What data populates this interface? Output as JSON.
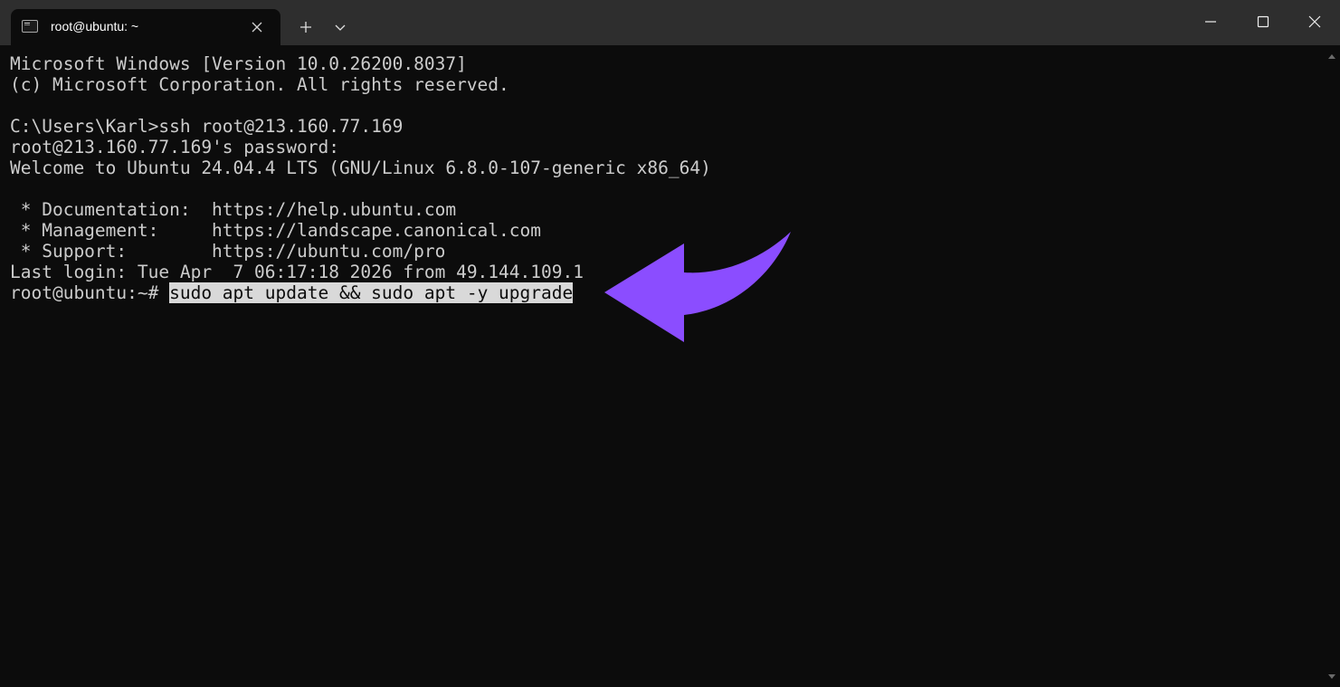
{
  "window": {
    "tab_title": "root@ubuntu: ~",
    "icons": {
      "tab": "terminal-icon",
      "tab_close": "close-icon",
      "new_tab": "plus-icon",
      "dropdown": "chevron-down-icon",
      "minimize": "minimize-icon",
      "maximize": "maximize-icon",
      "close": "close-icon"
    },
    "colors": {
      "titlebar": "#2e2e2e",
      "background": "#0c0c0c",
      "text": "#cccccc",
      "selection": "#d9d9d9",
      "arrow": "#8b4dff"
    }
  },
  "terminal": {
    "lines": [
      "Microsoft Windows [Version 10.0.26200.8037]",
      "(c) Microsoft Corporation. All rights reserved.",
      "",
      "C:\\Users\\Karl>ssh root@213.160.77.169",
      "root@213.160.77.169's password:",
      "Welcome to Ubuntu 24.04.4 LTS (GNU/Linux 6.8.0-107-generic x86_64)",
      "",
      " * Documentation:  https://help.ubuntu.com",
      " * Management:     https://landscape.canonical.com",
      " * Support:        https://ubuntu.com/pro",
      "Last login: Tue Apr  7 06:17:18 2026 from 49.144.109.1"
    ],
    "prompt": "root@ubuntu:~# ",
    "selected_command": "sudo apt update && sudo apt -y upgrade"
  }
}
